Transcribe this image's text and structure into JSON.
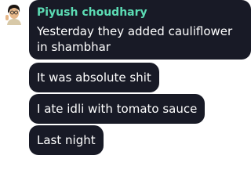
{
  "chat": {
    "sender_name": "Piyush choudhary",
    "sender_name_color": "#5cdcb4",
    "bubble_color": "#181a26",
    "avatar": "avatar-icon",
    "messages": [
      {
        "text": "Yesterday they added cauliflower in shambhar"
      },
      {
        "text": "It was absolute shit"
      },
      {
        "text": "I ate idli with tomato sauce"
      },
      {
        "text": "Last night"
      }
    ]
  }
}
